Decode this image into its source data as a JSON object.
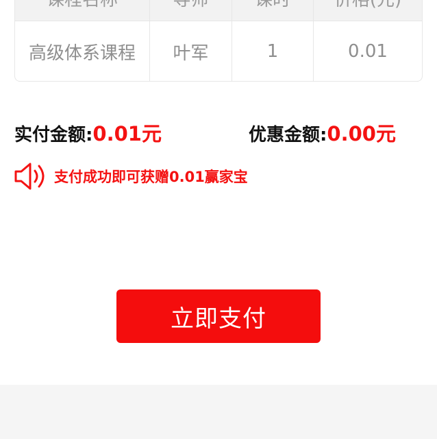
{
  "table": {
    "headers": [
      "课程名称",
      "导师",
      "课时",
      "价格(元)"
    ],
    "rows": [
      [
        "高级体系课程",
        "叶军",
        "1",
        "0.01"
      ]
    ]
  },
  "summary": {
    "paid_label": "实付金额:",
    "paid_value": "0.01元",
    "discount_label": "优惠金额:",
    "discount_value": "0.00元"
  },
  "notice": {
    "icon": "speaker-icon",
    "text": "支付成功即可获赠0.01赢家宝"
  },
  "pay_button": {
    "label": "立即支付"
  },
  "colors": {
    "accent": "#f41212",
    "button_bg": "#f40d0d",
    "page_bg": "#f5f5f5"
  }
}
